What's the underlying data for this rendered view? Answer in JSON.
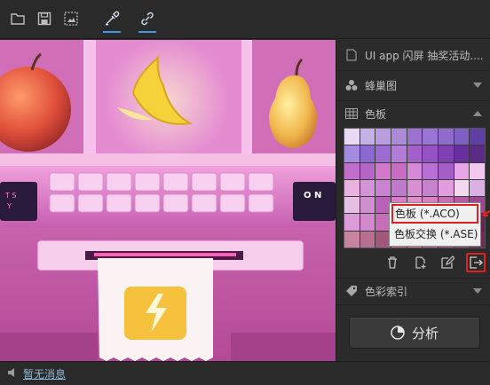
{
  "toolbar": {
    "buttons": [
      {
        "name": "open-folder-icon"
      },
      {
        "name": "save-icon"
      },
      {
        "name": "screenshot-icon"
      },
      {
        "name": "eyedropper-icon",
        "active": true
      },
      {
        "name": "link-icon",
        "active": true
      }
    ],
    "active_color": "#3f9be0"
  },
  "panel": {
    "project": {
      "label": "UI app 闪屏 抽奖活动...."
    },
    "honeycomb": {
      "label": "蜂巢图"
    },
    "palette": {
      "label": "色板"
    },
    "color_index": {
      "label": "色彩索引"
    },
    "analyze_label": "分析",
    "swatches": [
      "#e9d9f5",
      "#c4b2e6",
      "#ba9fe0",
      "#ab8ad8",
      "#9d71cf",
      "#9a76d4",
      "#8f6ccc",
      "#7f5fc2",
      "#5f3fa6",
      "#a38be0",
      "#8b69d0",
      "#9b6cd2",
      "#b17bd7",
      "#a161c9",
      "#9452c2",
      "#7f40b3",
      "#6a2f9e",
      "#5a2a86",
      "#c06fcc",
      "#b466c6",
      "#d178cb",
      "#c86dc1",
      "#d48ad6",
      "#b770d4",
      "#a45ec8",
      "#e7a4e6",
      "#f2c8ee",
      "#eab3df",
      "#d495d8",
      "#c983d1",
      "#bf79cd",
      "#d990d3",
      "#c583cd",
      "#e49ce0",
      "#f2d9ef",
      "#d9b1e3",
      "#e5c0e3",
      "#cf8fcf",
      "#b961b9",
      "#d97bc8",
      "#e08ec6",
      "#d781c4",
      "#c86eb6",
      "#b65ba6",
      "#9e4892",
      "#db9bd6",
      "#d188cc",
      "#c66eb8",
      "#a9488e",
      "#9a3b80",
      "#b64f99",
      "#cc65af",
      "#e07fc5",
      "#6a2350",
      "#c7849f",
      "#b86e8e",
      "#a3577a",
      "#c96a93",
      "#d8789f",
      "#b96694",
      "#a35586",
      "#8d4477",
      "#6e2c5a"
    ],
    "context_menu": {
      "items": [
        "色板 (*.ACO)",
        "色板交换 (*.ASE)"
      ],
      "highlight_color": "#e02020"
    },
    "palette_tools": [
      {
        "name": "delete-icon"
      },
      {
        "name": "add-file-icon"
      },
      {
        "name": "edit-icon"
      },
      {
        "name": "export-icon",
        "highlighted": true
      }
    ]
  },
  "statusbar": {
    "message": "暂无消息"
  }
}
